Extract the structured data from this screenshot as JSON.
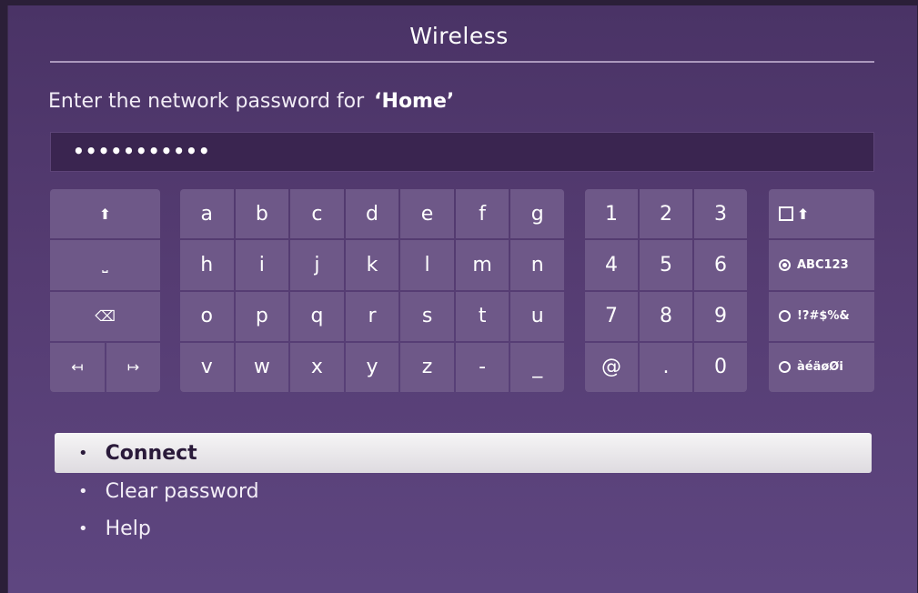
{
  "screen_title": "Wireless",
  "prompt": {
    "text": "Enter the network password for",
    "network": "‘Home’"
  },
  "password": {
    "masked_value": "•••••••••••"
  },
  "keyboard": {
    "control_keys": {
      "shift": "⬆",
      "space": "⎵",
      "backspace": "⌫",
      "cursor_left": "↤",
      "cursor_right": "↦"
    },
    "letters": [
      "a",
      "b",
      "c",
      "d",
      "e",
      "f",
      "g",
      "h",
      "i",
      "j",
      "k",
      "l",
      "m",
      "n",
      "o",
      "p",
      "q",
      "r",
      "s",
      "t",
      "u",
      "v",
      "w",
      "x",
      "y",
      "z",
      "-",
      "_"
    ],
    "digits": [
      "1",
      "2",
      "3",
      "4",
      "5",
      "6",
      "7",
      "8",
      "9",
      "@",
      ".",
      "0"
    ],
    "modes": {
      "caps_icon": "⬆",
      "abc123": "ABC123",
      "symbols": "!?#$%&",
      "accents": "àéäøØi",
      "selected": "ABC123"
    }
  },
  "menu": [
    {
      "label": "Connect",
      "selected": true
    },
    {
      "label": "Clear password",
      "selected": false
    },
    {
      "label": "Help",
      "selected": false
    }
  ],
  "colors": {
    "background": "#553c72",
    "key": "#6e5888",
    "selected_item": "#f0eef1"
  }
}
